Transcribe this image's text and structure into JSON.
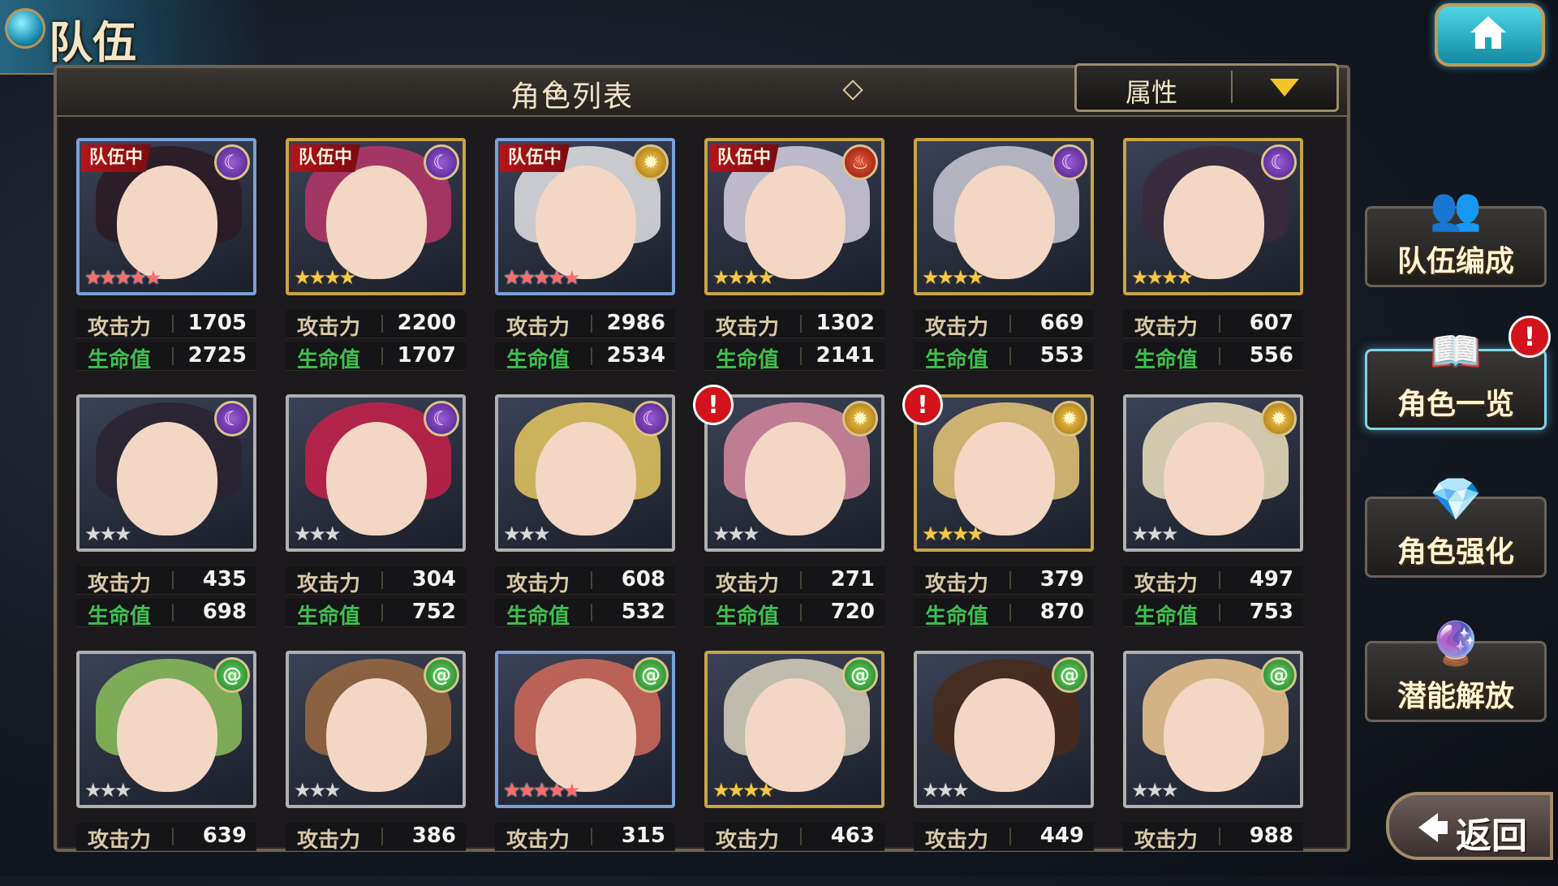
{
  "header": {
    "title": "队伍"
  },
  "panel": {
    "title": "角色列表",
    "sort_label": "属性"
  },
  "side_menu": [
    {
      "label": "队伍编成",
      "icon": "team-characters-icon",
      "alert": false,
      "active": false
    },
    {
      "label": "角色一览",
      "icon": "book-icon",
      "alert": true,
      "active": true
    },
    {
      "label": "角色强化",
      "icon": "crystal-icon",
      "alert": false,
      "active": false
    },
    {
      "label": "潜能解放",
      "icon": "orb-icon",
      "alert": false,
      "active": false
    }
  ],
  "back_label": "返回",
  "stat_labels": {
    "atk": "攻击力",
    "hp": "生命值"
  },
  "team_badge": "队伍中",
  "cards": [
    {
      "element": "moon",
      "stars": 5,
      "in_team": true,
      "alert": false,
      "atk": "1705",
      "hp": "2725",
      "frame": "blue"
    },
    {
      "element": "moon",
      "stars": 4,
      "in_team": true,
      "alert": false,
      "atk": "2200",
      "hp": "1707",
      "frame": "gold"
    },
    {
      "element": "sun",
      "stars": 5,
      "in_team": true,
      "alert": false,
      "atk": "2986",
      "hp": "2534",
      "frame": "blue"
    },
    {
      "element": "fire",
      "stars": 4,
      "in_team": true,
      "alert": false,
      "atk": "1302",
      "hp": "2141",
      "frame": "gold"
    },
    {
      "element": "moon",
      "stars": 4,
      "in_team": false,
      "alert": false,
      "atk": "669",
      "hp": "553",
      "frame": "gold"
    },
    {
      "element": "moon",
      "stars": 4,
      "in_team": false,
      "alert": false,
      "atk": "607",
      "hp": "556",
      "frame": "gold"
    },
    {
      "element": "moon",
      "stars": 3,
      "in_team": false,
      "alert": false,
      "atk": "435",
      "hp": "698",
      "frame": "silver"
    },
    {
      "element": "moon",
      "stars": 3,
      "in_team": false,
      "alert": false,
      "atk": "304",
      "hp": "752",
      "frame": "silver"
    },
    {
      "element": "moon",
      "stars": 3,
      "in_team": false,
      "alert": false,
      "atk": "608",
      "hp": "532",
      "frame": "silver"
    },
    {
      "element": "sun",
      "stars": 3,
      "in_team": false,
      "alert": true,
      "atk": "271",
      "hp": "720",
      "frame": "silver"
    },
    {
      "element": "sun",
      "stars": 4,
      "in_team": false,
      "alert": true,
      "atk": "379",
      "hp": "870",
      "frame": "gold"
    },
    {
      "element": "sun",
      "stars": 3,
      "in_team": false,
      "alert": false,
      "atk": "497",
      "hp": "753",
      "frame": "silver"
    },
    {
      "element": "wind",
      "stars": 3,
      "in_team": false,
      "alert": false,
      "atk": "639",
      "hp": "",
      "frame": "silver"
    },
    {
      "element": "wind",
      "stars": 3,
      "in_team": false,
      "alert": false,
      "atk": "386",
      "hp": "",
      "frame": "silver"
    },
    {
      "element": "wind",
      "stars": 5,
      "in_team": false,
      "alert": false,
      "atk": "315",
      "hp": "",
      "frame": "blue"
    },
    {
      "element": "wind",
      "stars": 4,
      "in_team": false,
      "alert": false,
      "atk": "463",
      "hp": "",
      "frame": "gold"
    },
    {
      "element": "wind",
      "stars": 3,
      "in_team": false,
      "alert": false,
      "atk": "449",
      "hp": "",
      "frame": "silver"
    },
    {
      "element": "wind",
      "stars": 3,
      "in_team": false,
      "alert": false,
      "atk": "988",
      "hp": "",
      "frame": "silver"
    }
  ]
}
